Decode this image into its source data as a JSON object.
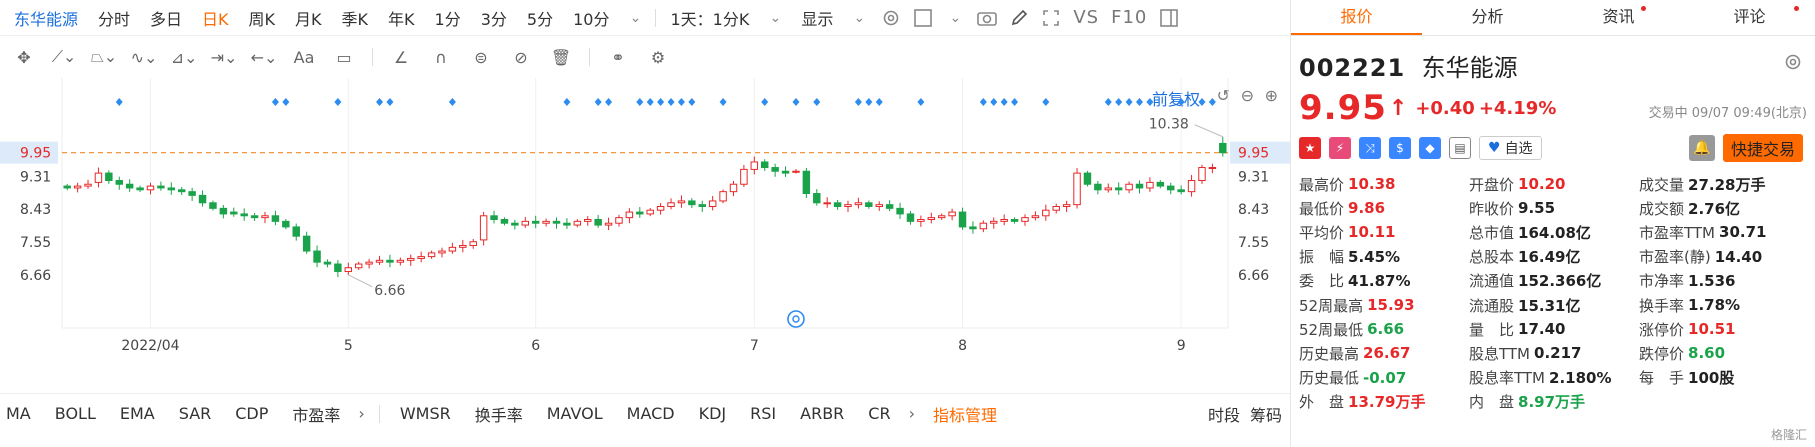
{
  "toolbar": {
    "stock_name": "东华能源",
    "periods": [
      "分时",
      "多日",
      "日K",
      "周K",
      "月K",
      "季K",
      "年K",
      "1分",
      "3分",
      "5分",
      "10分"
    ],
    "active_period": "日K",
    "interval_select": "1天：1分K",
    "display_select": "显示",
    "vs_label": "VS",
    "f10_label": "F10"
  },
  "chart_controls": {
    "adjust": "前复权"
  },
  "bottom": {
    "indicators": [
      "MA",
      "BOLL",
      "EMA",
      "SAR",
      "CDP",
      "市盈率"
    ],
    "indicators2": [
      "WMSR",
      "换手率",
      "MAVOL",
      "MACD",
      "KDJ",
      "RSI",
      "ARBR",
      "CR"
    ],
    "manager": "指标管理",
    "right_tabs": [
      "时段",
      "筹码"
    ]
  },
  "panel": {
    "tabs": [
      "报价",
      "分析",
      "资讯",
      "评论"
    ],
    "code": "002221",
    "name": "东华能源",
    "price": "9.95",
    "change": "+0.40",
    "change_pct": "+4.19%",
    "status": "交易中 09/07 09:49(北京)",
    "watch_label": "自选",
    "quick_trade": "快捷交易",
    "watermark": "格隆汇",
    "quotes": [
      [
        {
          "l": "最高价",
          "v": "10.38",
          "c": "red"
        },
        {
          "l": "开盘价",
          "v": "10.20",
          "c": "red"
        },
        {
          "l": "成交量",
          "v": "27.28万手",
          "c": ""
        }
      ],
      [
        {
          "l": "最低价",
          "v": "9.86",
          "c": "red"
        },
        {
          "l": "昨收价",
          "v": "9.55",
          "c": ""
        },
        {
          "l": "成交额",
          "v": "2.76亿",
          "c": ""
        }
      ],
      [
        {
          "l": "平均价",
          "v": "10.11",
          "c": "red"
        },
        {
          "l": "总市值",
          "v": "164.08亿",
          "c": ""
        },
        {
          "l": "市盈率TTM",
          "v": "30.71",
          "c": ""
        }
      ],
      [
        {
          "l": "振　幅",
          "v": "5.45%",
          "c": ""
        },
        {
          "l": "总股本",
          "v": "16.49亿",
          "c": ""
        },
        {
          "l": "市盈率(静)",
          "v": "14.40",
          "c": ""
        }
      ],
      [
        {
          "l": "委　比",
          "v": "41.87%",
          "c": ""
        },
        {
          "l": "流通值",
          "v": "152.366亿",
          "c": ""
        },
        {
          "l": "市净率",
          "v": "1.536",
          "c": ""
        }
      ],
      [
        {
          "l": "52周最高",
          "v": "15.93",
          "c": "red"
        },
        {
          "l": "流通股",
          "v": "15.31亿",
          "c": ""
        },
        {
          "l": "换手率",
          "v": "1.78%",
          "c": ""
        }
      ],
      [
        {
          "l": "52周最低",
          "v": "6.66",
          "c": "green"
        },
        {
          "l": "量　比",
          "v": "17.40",
          "c": ""
        },
        {
          "l": "涨停价",
          "v": "10.51",
          "c": "red"
        }
      ],
      [
        {
          "l": "历史最高",
          "v": "26.67",
          "c": "red"
        },
        {
          "l": "股息TTM",
          "v": "0.217",
          "c": ""
        },
        {
          "l": "跌停价",
          "v": "8.60",
          "c": "green"
        }
      ],
      [
        {
          "l": "历史最低",
          "v": "-0.07",
          "c": "green"
        },
        {
          "l": "股息率TTM",
          "v": "2.180%",
          "c": ""
        },
        {
          "l": "每　手",
          "v": "100股",
          "c": ""
        }
      ],
      [
        {
          "l": "外　盘",
          "v": "13.79万手",
          "c": "red"
        },
        {
          "l": "内　盘",
          "v": "8.97万手",
          "c": "green"
        },
        {
          "l": "",
          "v": "",
          "c": ""
        }
      ]
    ]
  },
  "chart_data": {
    "type": "candlestick",
    "y_ticks": [
      "9.95",
      "9.31",
      "8.43",
      "7.55",
      "6.66"
    ],
    "y_tick_values": [
      9.95,
      9.31,
      8.43,
      7.55,
      6.66
    ],
    "ylim": [
      5.9,
      10.75
    ],
    "x_labels": [
      "2022/04",
      "5",
      "6",
      "7",
      "8",
      "9"
    ],
    "x_label_index": [
      8,
      27,
      45,
      66,
      86,
      107
    ],
    "last_price": 9.95,
    "high_label": "10.38",
    "low_label": "6.66",
    "high_index": 111,
    "low_index": 27,
    "n_bars": 112,
    "up_color": "#e62828",
    "down_color": "#1aa34a",
    "price_line_color": "#f08a24",
    "event_marker_index": [
      5,
      20,
      21,
      26,
      30,
      31,
      37,
      48,
      51,
      52,
      55,
      56,
      57,
      58,
      59,
      60,
      63,
      67,
      70,
      72,
      76,
      77,
      78,
      82,
      88,
      89,
      90,
      91,
      94,
      100,
      101,
      102,
      103,
      104,
      107,
      109,
      110
    ],
    "closes": [
      9.0,
      9.05,
      9.1,
      9.4,
      9.2,
      9.1,
      9.0,
      8.95,
      9.05,
      9.0,
      8.95,
      8.9,
      8.8,
      8.6,
      8.45,
      8.3,
      8.3,
      8.25,
      8.2,
      8.25,
      8.1,
      7.95,
      7.7,
      7.3,
      7.0,
      6.95,
      6.75,
      6.85,
      6.95,
      7.0,
      7.05,
      7.0,
      7.05,
      7.1,
      7.15,
      7.25,
      7.3,
      7.4,
      7.45,
      7.55,
      8.25,
      8.15,
      8.05,
      8.0,
      8.1,
      8.05,
      8.1,
      8.05,
      8.0,
      8.1,
      8.15,
      8.0,
      8.05,
      8.2,
      8.35,
      8.3,
      8.4,
      8.5,
      8.6,
      8.65,
      8.55,
      8.5,
      8.65,
      8.9,
      9.1,
      9.5,
      9.7,
      9.55,
      9.45,
      9.4,
      9.45,
      8.85,
      8.6,
      8.6,
      8.5,
      8.55,
      8.6,
      8.5,
      8.55,
      8.45,
      8.3,
      8.1,
      8.15,
      8.2,
      8.25,
      8.35,
      7.95,
      7.9,
      8.05,
      8.1,
      8.15,
      8.1,
      8.2,
      8.25,
      8.4,
      8.5,
      8.55,
      9.4,
      9.1,
      8.95,
      9.0,
      8.95,
      9.1,
      9.0,
      9.15,
      9.05,
      8.95,
      8.9,
      9.2,
      9.55,
      9.55,
      9.95
    ],
    "opens": [
      9.05,
      9.0,
      9.05,
      9.15,
      9.4,
      9.2,
      9.1,
      9.0,
      8.95,
      9.05,
      9.0,
      8.95,
      8.9,
      8.8,
      8.6,
      8.45,
      8.35,
      8.3,
      8.25,
      8.2,
      8.25,
      8.1,
      7.95,
      7.7,
      7.3,
      7.0,
      6.95,
      6.75,
      6.85,
      6.95,
      7.0,
      7.05,
      7.0,
      7.05,
      7.1,
      7.15,
      7.25,
      7.3,
      7.4,
      7.45,
      7.6,
      8.25,
      8.15,
      8.05,
      8.0,
      8.1,
      8.05,
      8.1,
      8.05,
      8.0,
      8.1,
      8.15,
      8.0,
      8.05,
      8.2,
      8.35,
      8.3,
      8.4,
      8.5,
      8.6,
      8.65,
      8.55,
      8.5,
      8.65,
      8.9,
      9.1,
      9.5,
      9.7,
      9.55,
      9.45,
      9.45,
      9.45,
      8.85,
      8.6,
      8.6,
      8.5,
      8.55,
      8.6,
      8.5,
      8.55,
      8.45,
      8.3,
      8.1,
      8.15,
      8.2,
      8.25,
      8.35,
      7.95,
      7.9,
      8.05,
      8.1,
      8.15,
      8.1,
      8.2,
      8.25,
      8.4,
      8.5,
      8.55,
      9.4,
      9.1,
      8.95,
      9.0,
      8.95,
      9.1,
      9.0,
      9.15,
      9.05,
      8.95,
      8.9,
      9.2,
      9.55,
      10.2
    ]
  }
}
